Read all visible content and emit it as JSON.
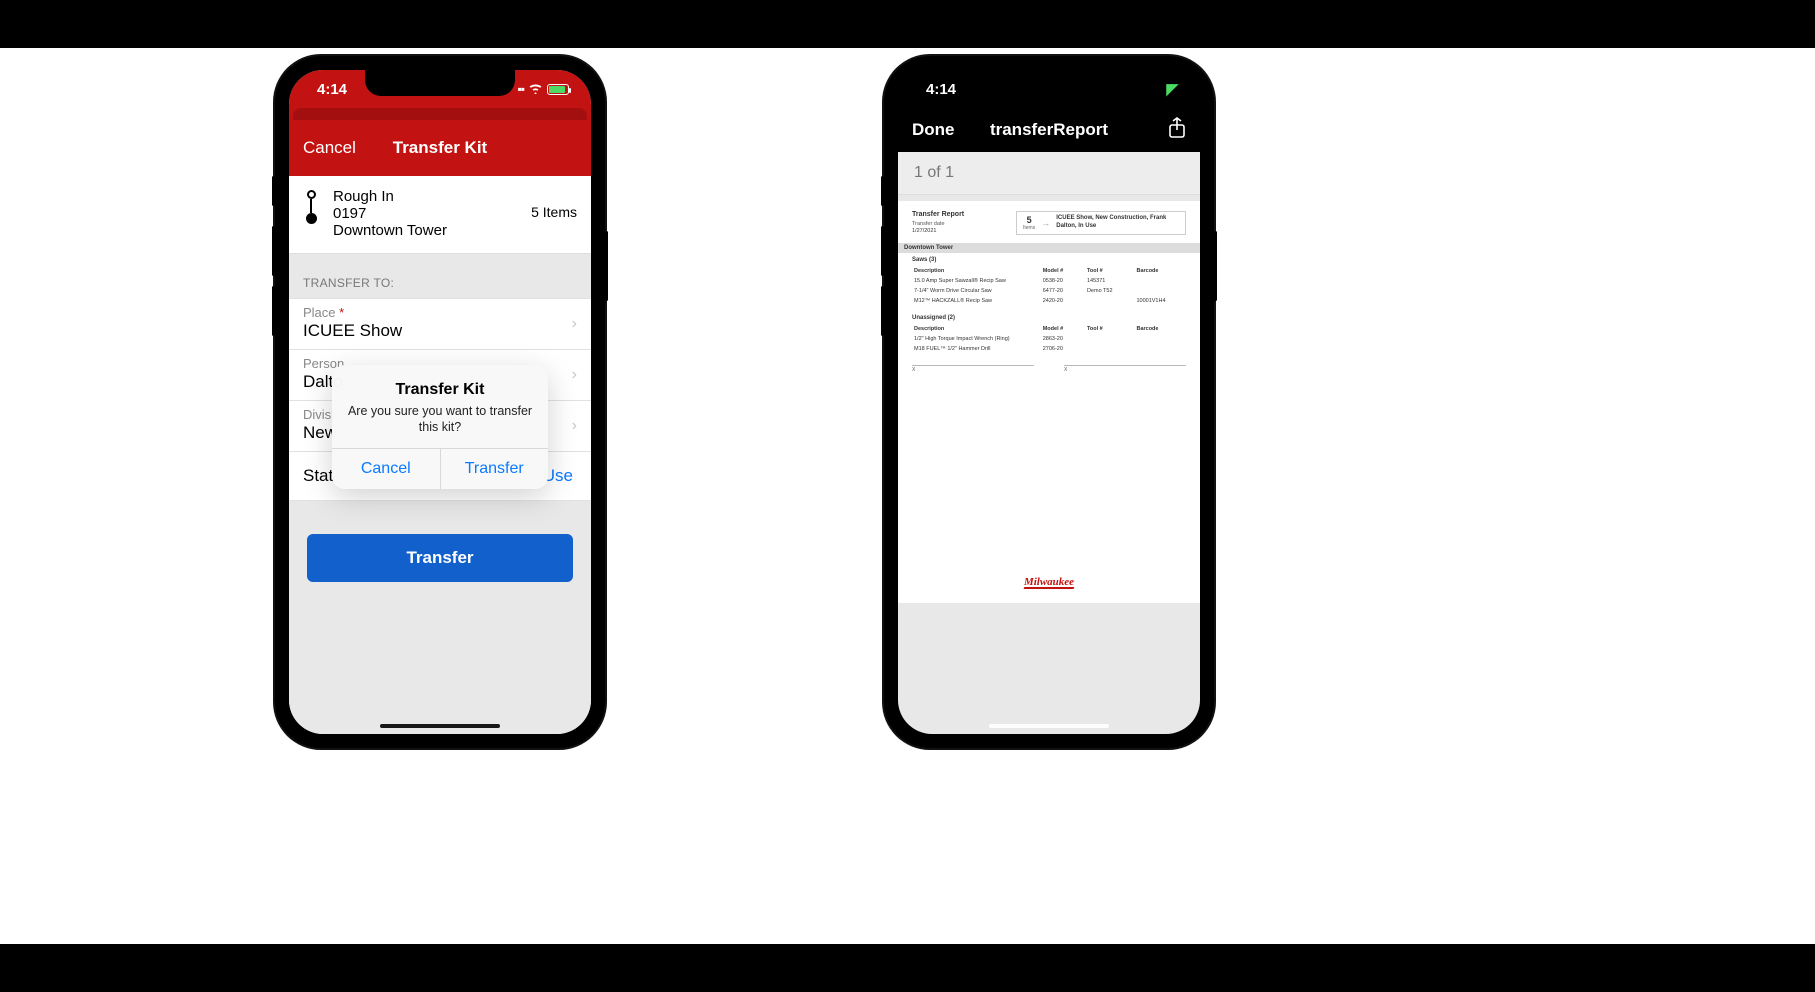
{
  "status": {
    "time": "4:14"
  },
  "left": {
    "header_cancel": "Cancel",
    "header_title": "Transfer Kit",
    "kit": {
      "name": "Rough In",
      "code": "0197",
      "location": "Downtown Tower",
      "count": "5 Items"
    },
    "section": "TRANSFER TO:",
    "rows": {
      "place_label": "Place",
      "place_value": "ICUEE Show",
      "person_label": "Person",
      "person_value": "Dalto",
      "division_label": "Divisi",
      "division_value": "New",
      "status_label": "Stat",
      "status_value": "Use"
    },
    "button": "Transfer",
    "alert": {
      "title": "Transfer Kit",
      "message": "Are you sure you want to transfer this kit?",
      "cancel": "Cancel",
      "confirm": "Transfer"
    }
  },
  "right": {
    "done": "Done",
    "title": "transferReport",
    "page_counter": "1 of 1",
    "report": {
      "heading": "Transfer Report",
      "date_label": "Transfer date",
      "date": "1/27/2021",
      "items_n": "5",
      "items_t": "Items",
      "destination": "ICUEE Show, New Construction, Frank Dalton, In Use",
      "band": "Downtown Tower",
      "group1": "Saws (3)",
      "cols": {
        "desc": "Description",
        "model": "Model #",
        "tool": "Tool #",
        "barcode": "Barcode"
      },
      "rows1": [
        {
          "desc": "15.0 Amp Super Sawzall® Recip Saw",
          "model": "0538-20",
          "tool": "145371",
          "barcode": ""
        },
        {
          "desc": "7-1/4\" Worm Drive Circular Saw",
          "model": "6477-20",
          "tool": "Demo T52",
          "barcode": ""
        },
        {
          "desc": "M12™ HACKZALL® Recip Saw",
          "model": "2420-20",
          "tool": "",
          "barcode": "10001V1H4"
        }
      ],
      "group2": "Unassigned (2)",
      "rows2": [
        {
          "desc": "1/2\" High Torque Impact Wrench (Ring)",
          "model": "2863-20",
          "tool": "",
          "barcode": ""
        },
        {
          "desc": "M18 FUEL™ 1/2\" Hammer Drill",
          "model": "2706-20",
          "tool": "",
          "barcode": ""
        }
      ],
      "sig": "X",
      "logo": "Milwaukee"
    }
  }
}
